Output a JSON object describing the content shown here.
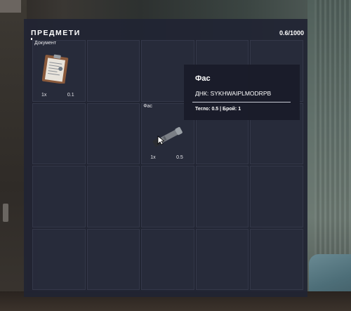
{
  "inventory": {
    "title": "ПРЕДМЕТИ",
    "capacity": "0.6/1000"
  },
  "items": [
    {
      "name": "Документ",
      "count": "1x",
      "weight": "0.1",
      "icon": "clipboard-document-icon"
    },
    {
      "name": "Фас",
      "count": "1x",
      "weight": "0.5",
      "icon": "flashlight-icon"
    }
  ],
  "tooltip": {
    "title": "Фас",
    "dna": "ДНК: SYKHWAIPLMODRPB",
    "stats": "Тегло: 0.5 | Брой: 1"
  },
  "colors": {
    "panel": "#212433",
    "cell": "#282b3b",
    "tooltip": "#1a1c29",
    "text": "#ffffff"
  }
}
